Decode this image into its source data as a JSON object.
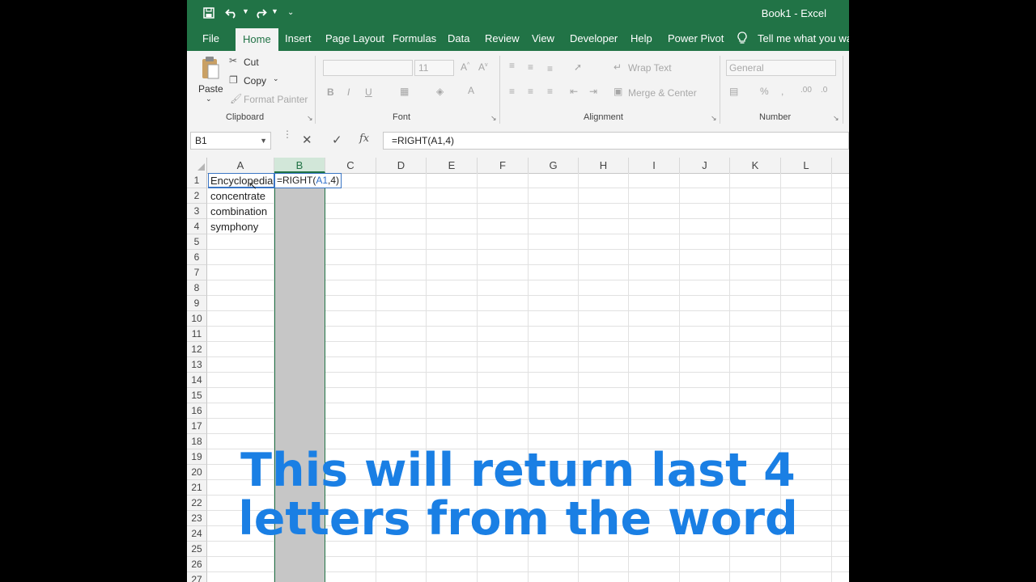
{
  "window": {
    "title": "Book1  -  Excel"
  },
  "tabs": [
    "File",
    "Home",
    "Insert",
    "Page Layout",
    "Formulas",
    "Data",
    "Review",
    "View",
    "Developer",
    "Help",
    "Power Pivot"
  ],
  "tell_me": "Tell me what you wan",
  "ribbon": {
    "clipboard": {
      "paste": "Paste",
      "cut": "Cut",
      "copy": "Copy",
      "format_painter": "Format Painter",
      "label": "Clipboard"
    },
    "font": {
      "size": "11",
      "label": "Font"
    },
    "alignment": {
      "wrap_text": "Wrap Text",
      "merge_center": "Merge & Center",
      "label": "Alignment"
    },
    "number": {
      "format": "General",
      "label": "Number"
    }
  },
  "formula_bar": {
    "name_box": "B1",
    "fx": "fx",
    "formula": "=RIGHT(A1,4)"
  },
  "columns": [
    "A",
    "B",
    "C",
    "D",
    "E",
    "F",
    "G",
    "H",
    "I",
    "J",
    "K",
    "L"
  ],
  "rows": [
    "1",
    "2",
    "3",
    "4",
    "5",
    "6",
    "7",
    "8",
    "9",
    "10",
    "11",
    "12",
    "13",
    "14",
    "15",
    "16",
    "17",
    "18",
    "19",
    "20",
    "21",
    "22",
    "23",
    "24",
    "25",
    "26",
    "27"
  ],
  "cells": {
    "A1": "Encyclopedia",
    "A2": "concentrate",
    "A3": "combination",
    "A4": "symphony"
  },
  "edit_cell": {
    "prefix": "=RIGHT(",
    "ref": "A1",
    "suffix": ",4)"
  },
  "caption": {
    "line1": "This will return last 4",
    "line2": "letters from the word"
  },
  "colors": {
    "excel_green": "#217346",
    "caption_blue": "#1a7fe4",
    "ref_blue": "#2f6fc9"
  }
}
